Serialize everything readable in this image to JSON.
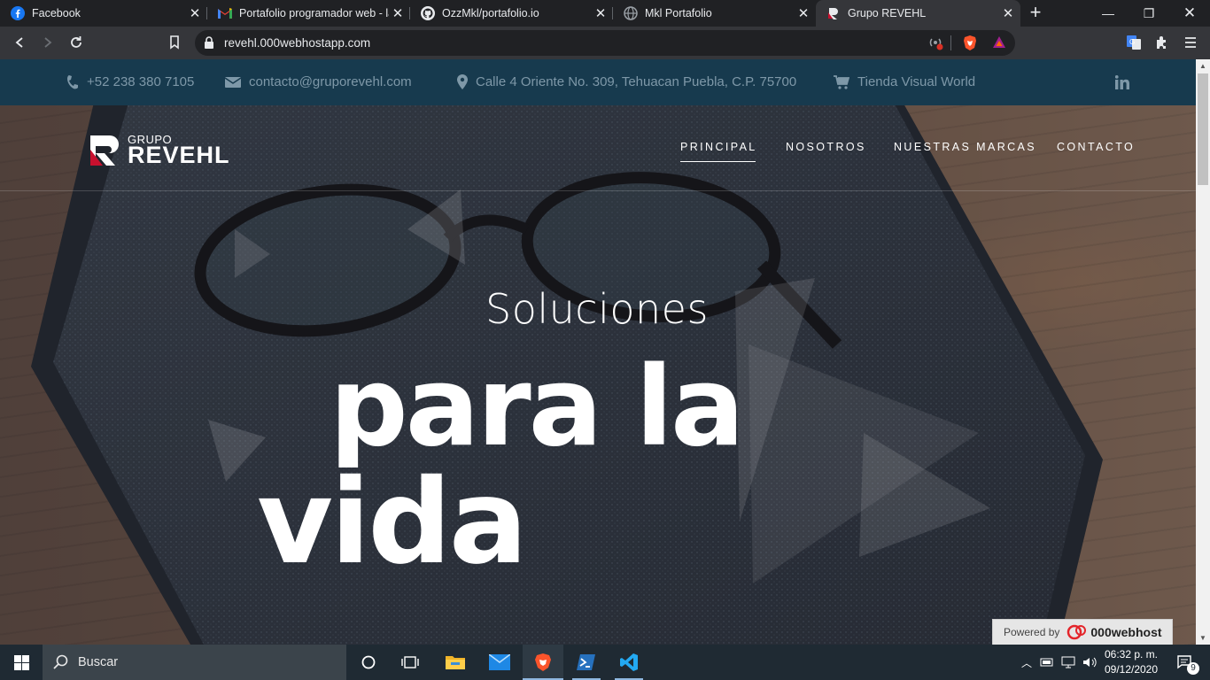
{
  "browser": {
    "tabs": [
      {
        "title": "Facebook",
        "icon": "facebook-icon"
      },
      {
        "title": "Portafolio programador web - lat",
        "icon": "gmail-icon"
      },
      {
        "title": "OzzMkl/portafolio.io",
        "icon": "github-icon"
      },
      {
        "title": "Mkl Portafolio",
        "icon": "globe-icon"
      },
      {
        "title": "Grupo REVEHL",
        "icon": "revehl-favicon-icon"
      }
    ],
    "url": "revehl.000webhostapp.com"
  },
  "topbar": {
    "phone": "+52 238 380 7105",
    "email": "contacto@gruporevehl.com",
    "address": "Calle 4 Oriente No. 309, Tehuacan Puebla, C.P. 75700",
    "store": "Tienda Visual World"
  },
  "header": {
    "logo_small": "GRUPO",
    "logo_big": "REVEHL",
    "nav": [
      {
        "label": "PRINCIPAL"
      },
      {
        "label": "NOSOTROS"
      },
      {
        "label": "NUESTRAS MARCAS"
      },
      {
        "label": "CONTACTO"
      }
    ]
  },
  "hero": {
    "line1": "Soluciones",
    "line2": "para la",
    "line3": "vida"
  },
  "powered": {
    "label": "Powered by",
    "brand": "000webhost"
  },
  "taskbar": {
    "search_placeholder": "Buscar",
    "time": "06:32 p. m.",
    "date": "09/12/2020",
    "notifications": "9"
  },
  "colors": {
    "topbar_bg": "#173a4e",
    "topbar_text": "#7e98a8",
    "taskbar_bg": "#1f2a33"
  }
}
